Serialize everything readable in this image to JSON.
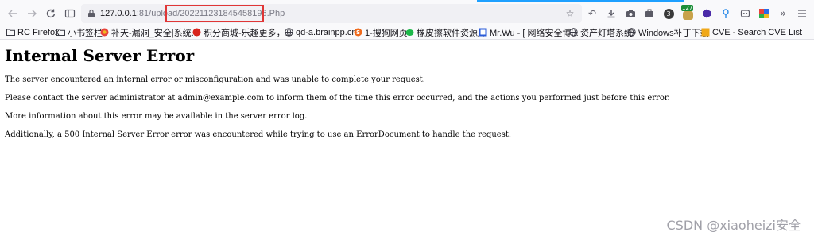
{
  "browser": {
    "url_host": "127.0.0.1",
    "url_rest": ":81/upload/202211231845458196.Php",
    "extension_badge": "127",
    "ext_count": "3"
  },
  "bookmarks": [
    "RC Firefox",
    "小书签栏",
    "补天-漏洞_安全|系统...",
    "积分商城-乐趣更多，...",
    "qd-a.brainpp.cn",
    "1-搜狗网页",
    "橡皮擦软件资源库",
    "Mr.Wu - [ 网络安全博...",
    "资产灯塔系统",
    "Windows补丁下载",
    "CVE - Search CVE List"
  ],
  "page": {
    "title": "Internal Server Error",
    "paragraphs": [
      "The server encountered an internal error or misconfiguration and was unable to complete your request.",
      "Please contact the server administrator at admin@example.com to inform them of the time this error occurred, and the actions you performed just before this error.",
      "More information about this error may be available in the server error log.",
      "Additionally, a 500 Internal Server Error error was encountered while trying to use an ErrorDocument to handle the request."
    ]
  },
  "watermark": "CSDN @xiaoheizi安全",
  "colors": {
    "highlight_border": "#e03636",
    "accent_blue": "#1ea0ff"
  }
}
